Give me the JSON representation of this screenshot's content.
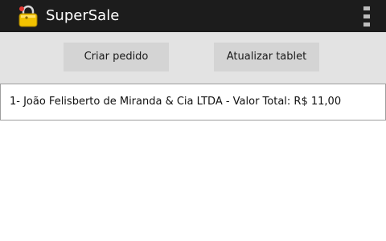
{
  "action_bar": {
    "app_icon": "lock-bag-icon",
    "title": "SuperSale",
    "overflow_icon": "overflow-menu-icon"
  },
  "buttons": {
    "criar_label": "Criar pedido",
    "atualizar_label": "Atualizar tablet"
  },
  "orders": [
    {
      "text": "1- João Felisberto de Miranda & Cia LTDA - Valor Total: R$ 11,00"
    }
  ],
  "colors": {
    "action_bar": "#1c1c1c",
    "button_panel": "#e3e3e3",
    "button": "#d4d4d4",
    "icon_yellow": "#f2c200"
  }
}
